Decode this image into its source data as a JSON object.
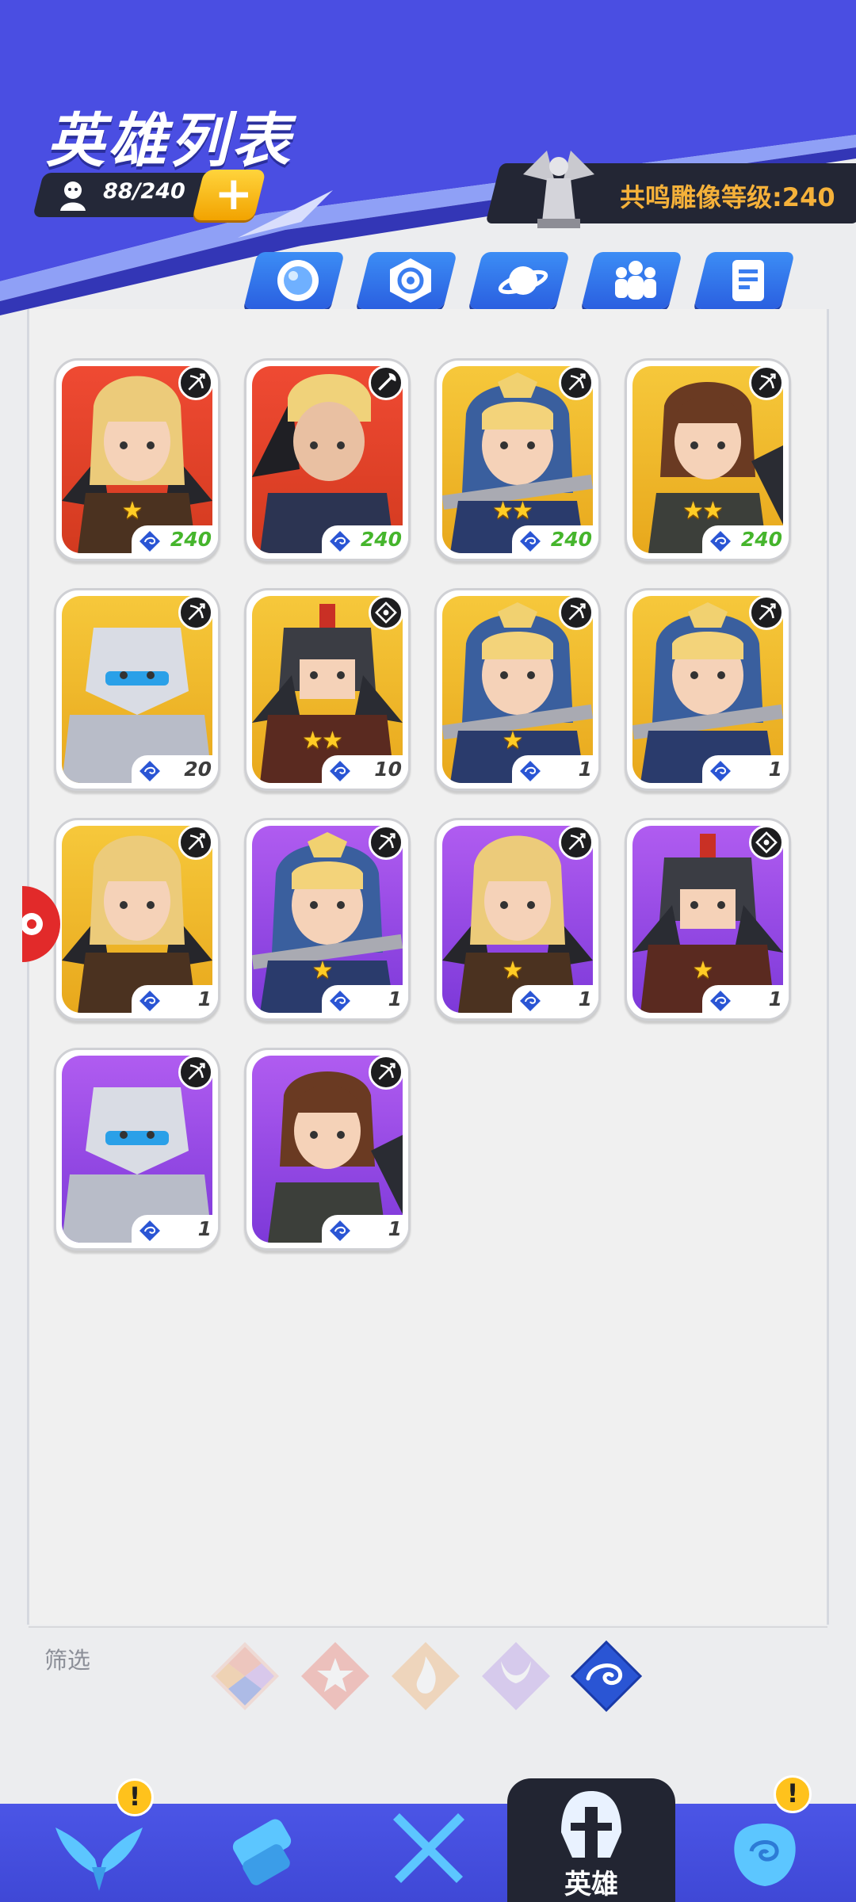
{
  "header": {
    "title": "英雄列表",
    "hero_count": "88/240",
    "add_label": "+",
    "statue_label": "共鸣雕像等级:240"
  },
  "categories": [
    {
      "label": "秘纹",
      "icon": "orb-icon"
    },
    {
      "label": "符文",
      "icon": "rune-swirl-icon"
    },
    {
      "label": "星核",
      "icon": "planet-icon"
    },
    {
      "label": "编队",
      "icon": "team-icon"
    },
    {
      "label": "图鉴",
      "icon": "book-icon"
    }
  ],
  "heroes": [
    {
      "name": "blonde-winged-woman",
      "bg": "red",
      "stars": "★",
      "level": "240",
      "class": "bow-icon"
    },
    {
      "name": "blonde-armored-man",
      "bg": "red",
      "stars": "",
      "level": "240",
      "class": "axe-icon"
    },
    {
      "name": "hooded-swordswoman",
      "bg": "gold",
      "stars": "★★",
      "level": "240",
      "class": "bow-icon"
    },
    {
      "name": "brunette-rogue",
      "bg": "gold",
      "stars": "★★",
      "level": "240",
      "class": "bow-icon"
    },
    {
      "name": "silver-mech-knight",
      "bg": "gold",
      "stars": "",
      "level": "20",
      "class": "bow-icon"
    },
    {
      "name": "helmeted-warrior",
      "bg": "gold",
      "stars": "★★",
      "level": "10",
      "class": "rune-icon"
    },
    {
      "name": "hooded-swordswoman",
      "bg": "gold",
      "stars": "★",
      "level": "1",
      "class": "bow-icon"
    },
    {
      "name": "hooded-swordswoman",
      "bg": "gold",
      "stars": "",
      "level": "1",
      "class": "bow-icon"
    },
    {
      "name": "blonde-winged-woman",
      "bg": "gold",
      "stars": "",
      "level": "1",
      "class": "bow-icon"
    },
    {
      "name": "hooded-swordswoman",
      "bg": "purple",
      "stars": "★",
      "level": "1",
      "class": "bow-icon"
    },
    {
      "name": "blonde-winged-woman",
      "bg": "purple",
      "stars": "★",
      "level": "1",
      "class": "bow-icon"
    },
    {
      "name": "helmeted-warrior",
      "bg": "purple",
      "stars": "★",
      "level": "1",
      "class": "rune-icon"
    },
    {
      "name": "silver-mech-knight",
      "bg": "purple",
      "stars": "",
      "level": "1",
      "class": "bow-icon"
    },
    {
      "name": "brunette-rogue",
      "bg": "purple",
      "stars": "",
      "level": "1",
      "class": "bow-icon"
    }
  ],
  "filter": {
    "label": "筛选",
    "options": [
      "all-elements",
      "star",
      "fire",
      "horns",
      "wind"
    ],
    "selected": "wind"
  },
  "nav": {
    "items": [
      "wings-icon",
      "scroll-icon",
      "crossed-swords-icon",
      "helmet-icon",
      "rune-stone-icon"
    ],
    "active_label": "英雄",
    "badge_text": "!"
  },
  "colors": {
    "header_blue": "#4a4fe0",
    "card_red": "#e2432a",
    "card_gold": "#f0b82c",
    "card_purple": "#9a4de6",
    "level_green": "#45b52c"
  }
}
